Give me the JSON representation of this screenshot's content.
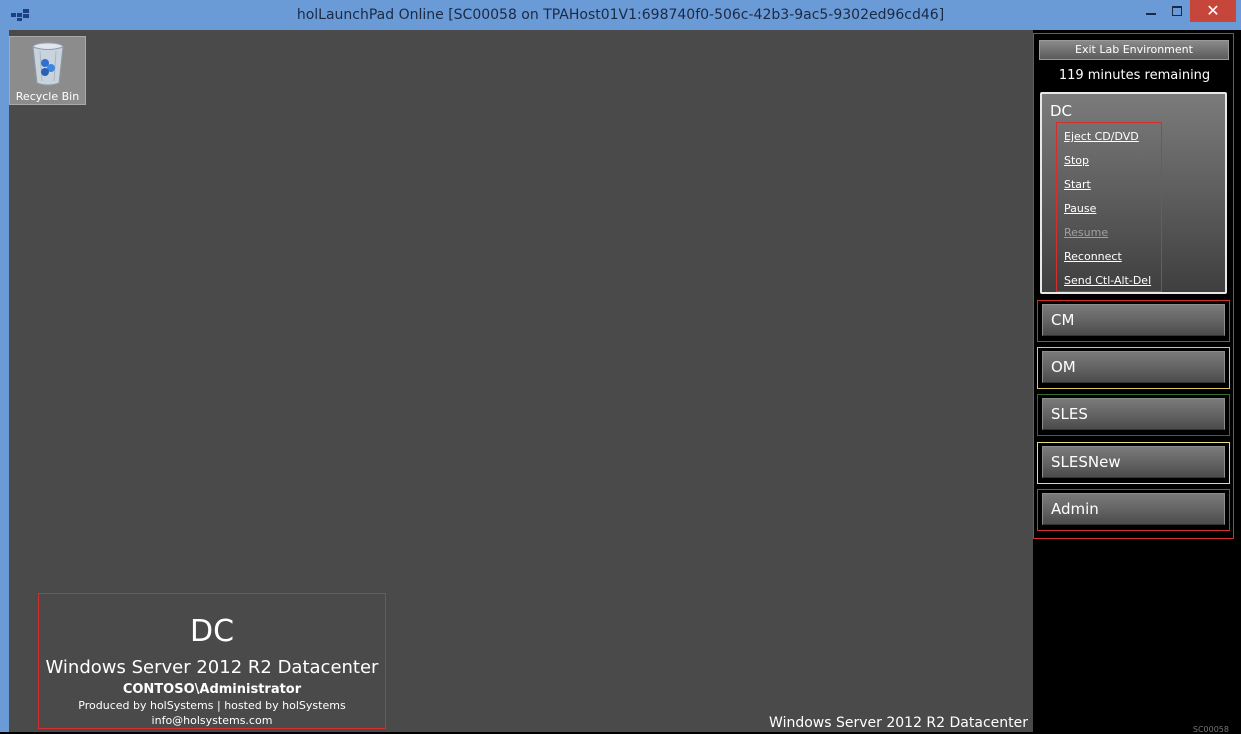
{
  "window": {
    "title": "holLaunchPad Online  [SC00058 on TPAHost01V1:698740f0-506c-42b3-9ac5-9302ed96cd46]",
    "close_glyph": "✕"
  },
  "desktop": {
    "recycle_bin_label": "Recycle Bin",
    "os_footer": "Windows Server 2012 R2 Datacenter"
  },
  "info": {
    "vm_name": "DC",
    "os": "Windows Server 2012 R2 Datacenter",
    "user": "CONTOSO\\Administrator",
    "produced_by": "Produced by holSystems | hosted by holSystems",
    "email": "info@holsystems.com"
  },
  "panel": {
    "exit_label": "Exit Lab Environment",
    "remaining": "119 minutes remaining",
    "corner_tag": "SC00058",
    "expanded_vm": {
      "name": "DC",
      "actions": [
        {
          "label": "Eject CD/DVD",
          "enabled": true
        },
        {
          "label": "Stop",
          "enabled": true
        },
        {
          "label": "Start",
          "enabled": true
        },
        {
          "label": "Pause",
          "enabled": true
        },
        {
          "label": "Resume",
          "enabled": false
        },
        {
          "label": "Reconnect",
          "enabled": true
        },
        {
          "label": "Send Ctl-Alt-Del",
          "enabled": true
        }
      ]
    },
    "vms": [
      {
        "name": "CM",
        "border_color": "#d22f2f"
      },
      {
        "name": "OM",
        "border_color": "#e3c65a"
      },
      {
        "name": "SLES",
        "border_color": "#2e6e2e"
      },
      {
        "name": "SLESNew",
        "border_color": "#e3df7a"
      },
      {
        "name": "Admin",
        "border_color": "#d22f2f"
      }
    ]
  }
}
